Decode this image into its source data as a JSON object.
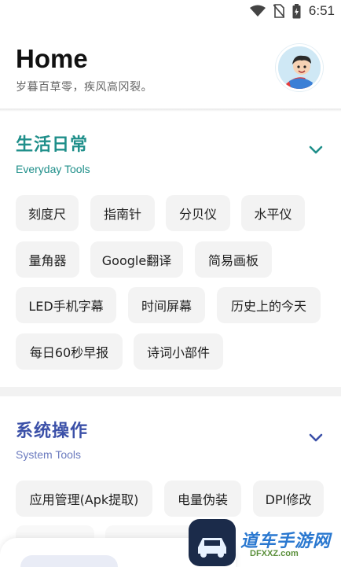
{
  "status_bar": {
    "time": "6:51",
    "icons": [
      "wifi-icon",
      "no-sim-icon",
      "battery-icon"
    ]
  },
  "header": {
    "title": "Home",
    "subtitle": "岁暮百草零，疾风高冈裂。"
  },
  "sections": [
    {
      "title": "生活日常",
      "subtitle": "Everyday Tools",
      "color": "#1f8f8a",
      "items": [
        "刻度尺",
        "指南针",
        "分贝仪",
        "水平仪",
        "量角器",
        "Google翻译",
        "简易画板",
        "LED手机字幕",
        "时间屏幕",
        "历史上的今天",
        "每日60秒早报",
        "诗词小部件"
      ]
    },
    {
      "title": "系统操作",
      "subtitle": "System Tools",
      "color": "#3b50a8",
      "items": [
        "应用管理(Apk提取)",
        "电量伪装",
        "DPI修改"
      ]
    }
  ],
  "watermark": {
    "text": "道车手游网",
    "url": "DFXXZ.com"
  }
}
